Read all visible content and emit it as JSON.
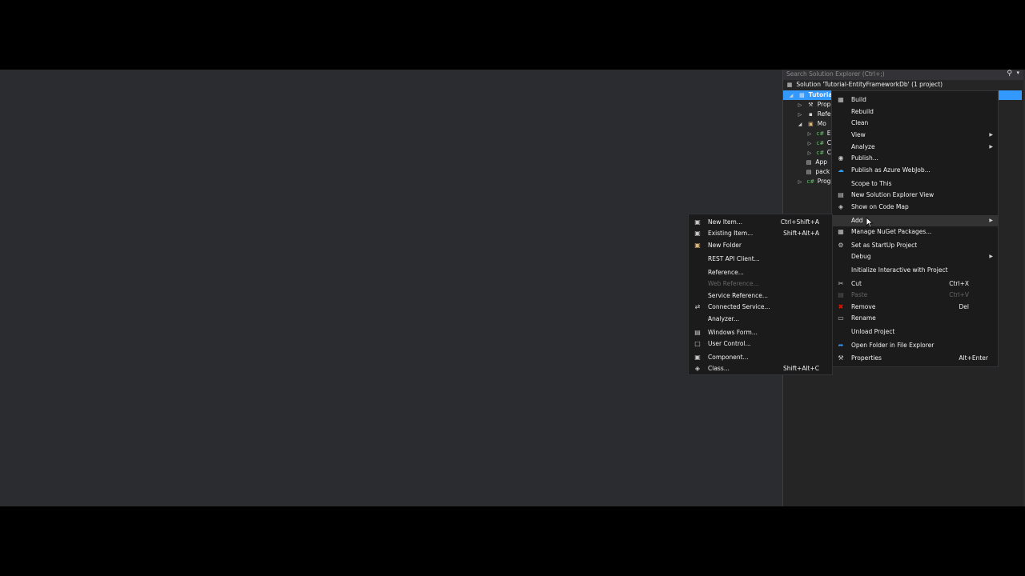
{
  "solution_explorer": {
    "search_placeholder": "Search Solution Explorer (Ctrl+;)",
    "tree": [
      {
        "label": "Solution 'Tutorial-EntityFrameworkDb' (1 project)"
      },
      {
        "label": "Tutorial"
      },
      {
        "label": "Prop"
      },
      {
        "label": "Refe"
      },
      {
        "label": "Mo"
      },
      {
        "label": "E"
      },
      {
        "label": "C"
      },
      {
        "label": "C"
      },
      {
        "label": "App"
      },
      {
        "label": "pack"
      },
      {
        "label": "Prog"
      }
    ]
  },
  "context_menu": {
    "items": [
      {
        "label": "Build"
      },
      {
        "label": "Rebuild"
      },
      {
        "label": "Clean"
      },
      {
        "label": "View"
      },
      {
        "label": "Analyze"
      },
      {
        "label": "Publish..."
      },
      {
        "label": "Publish as Azure WebJob..."
      },
      {
        "label": "Scope to This"
      },
      {
        "label": "New Solution Explorer View"
      },
      {
        "label": "Show on Code Map"
      },
      {
        "label": "Add"
      },
      {
        "label": "Manage NuGet Packages..."
      },
      {
        "label": "Set as StartUp Project"
      },
      {
        "label": "Debug"
      },
      {
        "label": "Initialize Interactive with Project"
      },
      {
        "label": "Cut",
        "shortcut": "Ctrl+X"
      },
      {
        "label": "Paste",
        "shortcut": "Ctrl+V"
      },
      {
        "label": "Remove",
        "shortcut": "Del"
      },
      {
        "label": "Rename"
      },
      {
        "label": "Unload Project"
      },
      {
        "label": "Open Folder in File Explorer"
      },
      {
        "label": "Properties",
        "shortcut": "Alt+Enter"
      }
    ]
  },
  "add_submenu": {
    "items": [
      {
        "label": "New Item...",
        "shortcut": "Ctrl+Shift+A"
      },
      {
        "label": "Existing Item...",
        "shortcut": "Shift+Alt+A"
      },
      {
        "label": "New Folder"
      },
      {
        "label": "REST API Client..."
      },
      {
        "label": "Reference..."
      },
      {
        "label": "Web Reference..."
      },
      {
        "label": "Service Reference..."
      },
      {
        "label": "Connected Service..."
      },
      {
        "label": "Analyzer..."
      },
      {
        "label": "Windows Form..."
      },
      {
        "label": "User Control..."
      },
      {
        "label": "Component..."
      },
      {
        "label": "Class...",
        "shortcut": "Shift+Alt+C"
      }
    ]
  },
  "colors": {
    "selection": "#3399ff",
    "menu_bg": "#1b1b1c",
    "panel_bg": "#252526",
    "editor_bg": "#2b2c30",
    "remove_icon": "#e51400",
    "azure_icon": "#2e9cf0"
  }
}
